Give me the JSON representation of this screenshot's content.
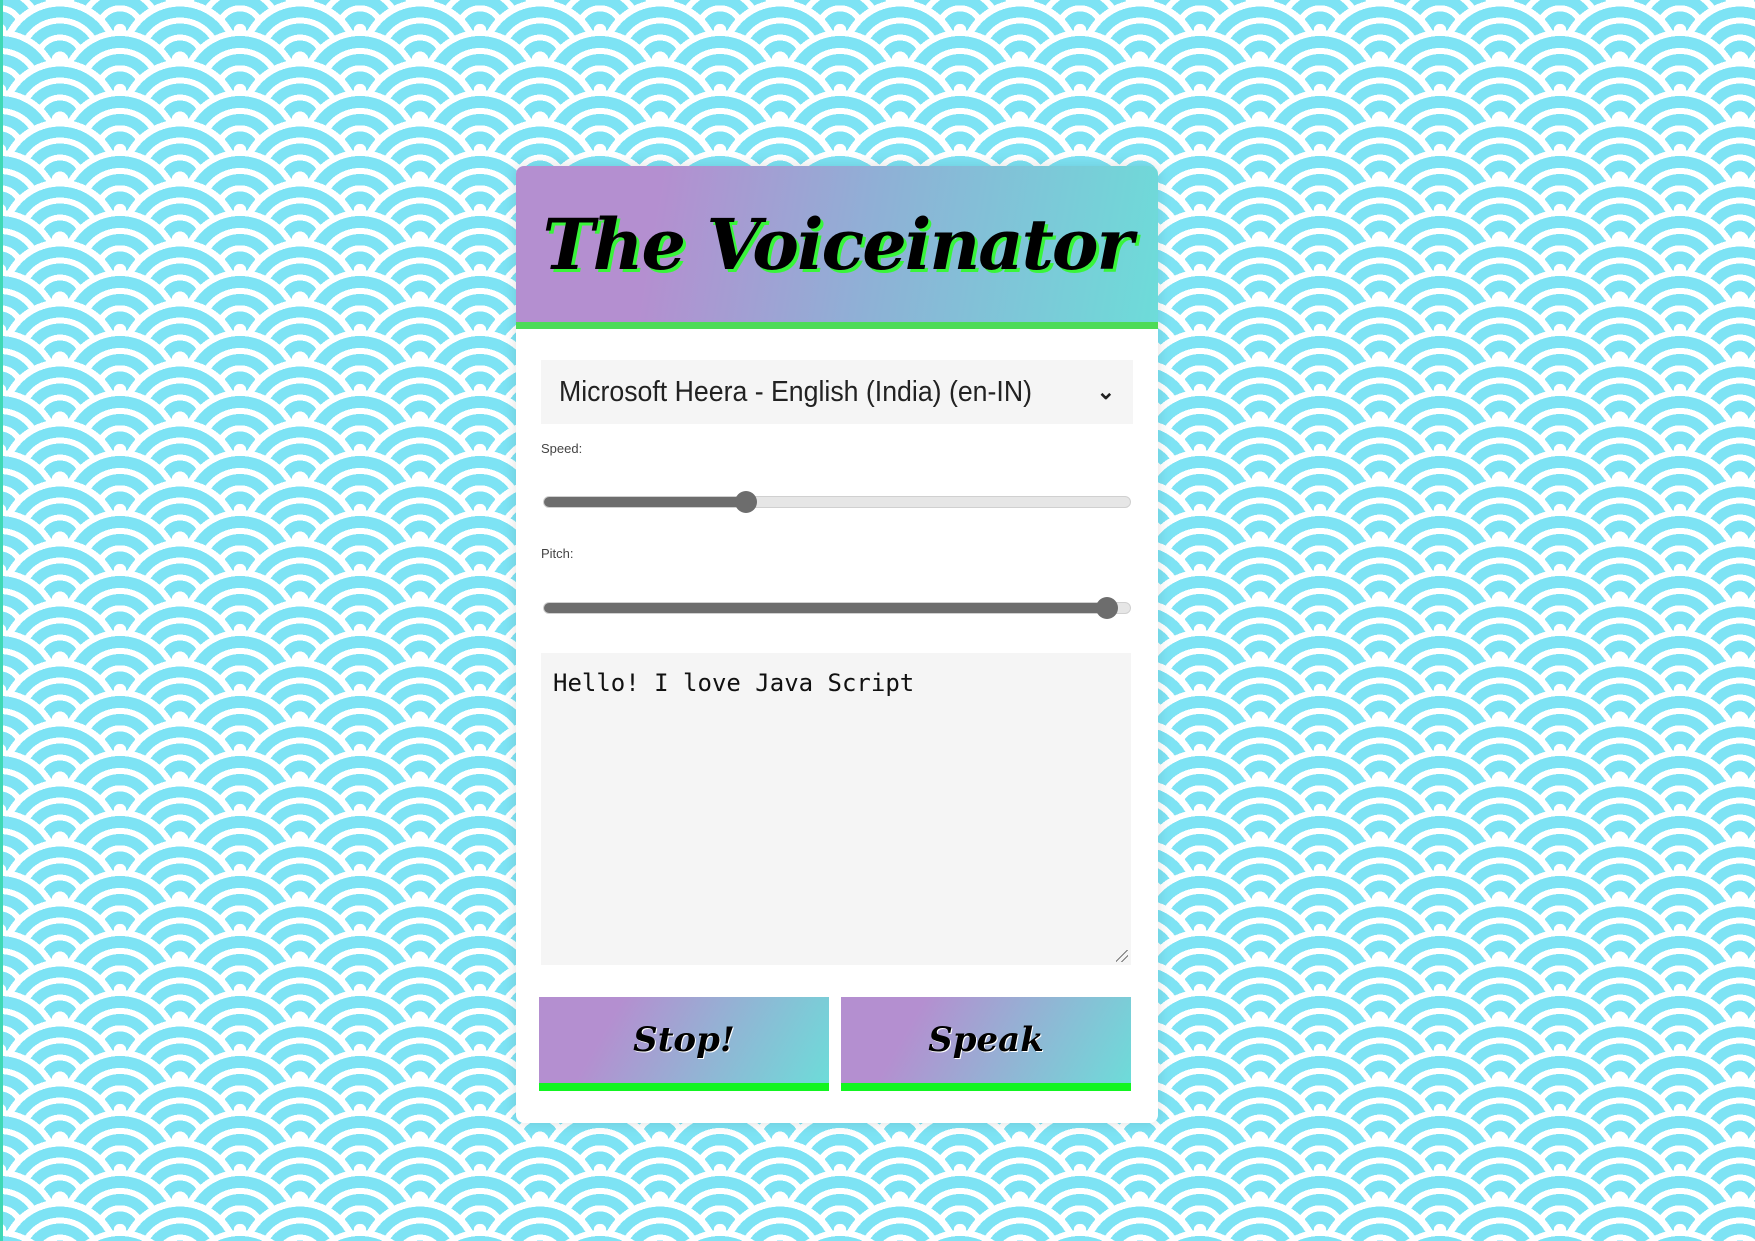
{
  "header": {
    "title": "The Voiceinator"
  },
  "voice_select": {
    "selected": "Microsoft Heera - English (India) (en-IN)",
    "icon": "chevron-down-icon"
  },
  "speed": {
    "label": "Speed:",
    "fraction": 0.345
  },
  "pitch": {
    "label": "Pitch:",
    "fraction": 0.96
  },
  "message": {
    "value": "Hello! I love Java Script"
  },
  "buttons": {
    "stop": "Stop!",
    "speak": "Speak"
  },
  "colors": {
    "accent_green": "#12f521",
    "gradient_start": "#b48fd0",
    "gradient_end": "#6ddcd9",
    "pattern": "#7de3f4"
  }
}
